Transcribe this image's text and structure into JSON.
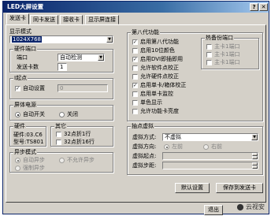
{
  "window": {
    "title": "LED大屏设置"
  },
  "tabs": [
    "发送卡",
    "同卡发送",
    "接收卡",
    "显示屏连接"
  ],
  "display_mode": {
    "label": "显示模式",
    "value": "1024X768"
  },
  "hardware_port": {
    "label": "硬件端口",
    "port_label": "端口",
    "port_value": "自动检测",
    "count_label": "发送卡数",
    "count_value": "1"
  },
  "dot": {
    "label": "I起点",
    "auto_label": "自动设置",
    "value": "0"
  },
  "power": {
    "label": "屏体电源",
    "auto": "自动开关",
    "off": "关闭"
  },
  "hardware": {
    "label": "硬件",
    "line1": "硬件:03.C6",
    "line2": "型号:TS801"
  },
  "other": {
    "label": "其它",
    "opt1": "32点折1行",
    "opt2": "32点折16行"
  },
  "async_mode": {
    "label": "异步模式",
    "opt1": "自动异步",
    "opt2": "不允许异步",
    "opt3": "强制异步"
  },
  "gen8": {
    "label": "第八代功能",
    "items": [
      {
        "label": "启用第八代功能",
        "checked": true
      },
      {
        "label": "启用10位颜色",
        "checked": false
      },
      {
        "label": "启用DVI即插即用",
        "checked": true
      },
      {
        "label": "允许软件点校正",
        "checked": false
      },
      {
        "label": "允许硬件点校正",
        "checked": false
      },
      {
        "label": "启用单卡/箱体校正",
        "checked": true
      },
      {
        "label": "启用单卡监控",
        "checked": false
      },
      {
        "label": "单色显示",
        "checked": false
      },
      {
        "label": "允许功能卡亮度",
        "checked": false
      }
    ]
  },
  "hot_backup": {
    "label": "热备份端口",
    "items": [
      "主卡1端口",
      "主卡1端口",
      "主卡1端口"
    ]
  },
  "dot_virtual": {
    "label": "抽点虚拟",
    "mode_label": "虚拟方式:",
    "mode_value": "不虚拟",
    "dir_label": "虚拟方向:",
    "dir_left": "左前",
    "dir_right": "右前",
    "start_label": "虚拟起点:",
    "step_label": "虚拟步距:"
  },
  "buttons": {
    "default": "默认设置",
    "save": "保存到发送卡",
    "exit": "退出"
  },
  "watermark": "云视安"
}
